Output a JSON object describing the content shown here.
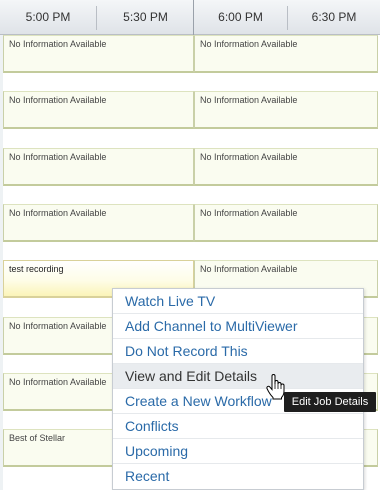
{
  "header": {
    "times": [
      "5:00 PM",
      "5:30 PM",
      "6:00 PM",
      "6:30 PM"
    ]
  },
  "guide": {
    "rows": [
      {
        "left": "No Information Available",
        "right": "No Information Available",
        "left_active": false
      },
      {
        "left": "No Information Available",
        "right": "No Information Available",
        "left_active": false
      },
      {
        "left": "No Information Available",
        "right": "No Information Available",
        "left_active": false
      },
      {
        "left": "No Information Available",
        "right": "No Information Available",
        "left_active": false
      },
      {
        "left": "test recording",
        "right": "No Information Available",
        "left_active": true
      },
      {
        "left": "No Information Available",
        "right": "",
        "left_active": false
      },
      {
        "left": "No Information Available",
        "right": "",
        "left_active": false
      },
      {
        "left": "Best of Stellar",
        "right": "",
        "left_active": false
      }
    ]
  },
  "context_menu": {
    "items": [
      {
        "label": "Watch Live TV",
        "name": "menu-item-watch-live-tv",
        "hovered": false
      },
      {
        "label": "Add Channel to MultiViewer",
        "name": "menu-item-add-channel-to-multiviewer",
        "hovered": false
      },
      {
        "label": "Do Not Record This",
        "name": "menu-item-do-not-record-this",
        "hovered": false
      },
      {
        "label": "View and Edit Details",
        "name": "menu-item-view-and-edit-details",
        "hovered": true
      },
      {
        "label": "Create a New Workflow",
        "name": "menu-item-create-a-new-workflow",
        "hovered": false
      },
      {
        "label": "Conflicts",
        "name": "menu-item-conflicts",
        "hovered": false
      },
      {
        "label": "Upcoming",
        "name": "menu-item-upcoming",
        "hovered": false
      },
      {
        "label": "Recent",
        "name": "menu-item-recent",
        "hovered": false
      }
    ]
  },
  "tooltip": {
    "text": "Edit Job Details"
  },
  "colors": {
    "menu_link": "#2a6aa8",
    "cell_bg": "#fafcf0",
    "active_cell_highlight": "#fbf4b8",
    "tooltip_bg": "#1e1e1e"
  },
  "icons": {
    "cursor": "hand-pointer-icon"
  }
}
